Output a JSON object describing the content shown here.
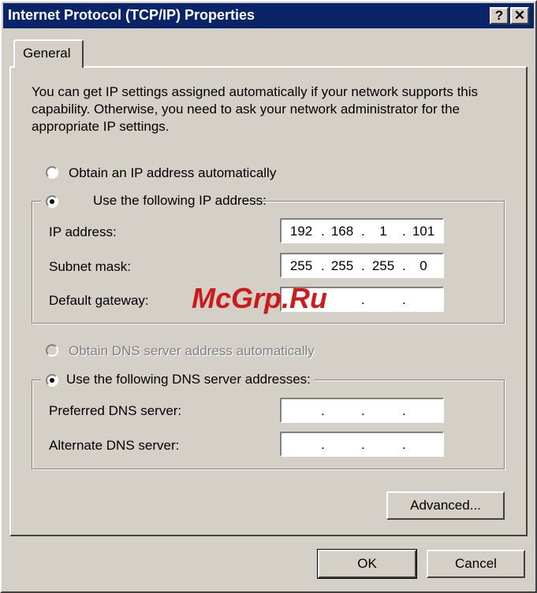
{
  "window": {
    "title": "Internet Protocol (TCP/IP) Properties",
    "help_glyph": "?",
    "close_glyph": "✕"
  },
  "tabs": [
    {
      "label": "General"
    }
  ],
  "description": "You can get IP settings assigned automatically if your network supports this capability. Otherwise, you need to ask your network administrator for the appropriate IP settings.",
  "ip": {
    "auto_option": {
      "label": "Obtain an IP address automatically",
      "selected": false
    },
    "manual_option": {
      "label": "Use the following IP address:",
      "selected": true
    },
    "fields": [
      {
        "label": "IP address:",
        "octets": [
          "192",
          "168",
          "1",
          "101"
        ]
      },
      {
        "label": "Subnet mask:",
        "octets": [
          "255",
          "255",
          "255",
          "0"
        ]
      },
      {
        "label": "Default gateway:",
        "octets": [
          "",
          "",
          "",
          ""
        ]
      }
    ]
  },
  "dns": {
    "auto_option": {
      "label": "Obtain DNS server address automatically",
      "selected": false,
      "disabled": true
    },
    "manual_option": {
      "label": "Use the following DNS server addresses:",
      "selected": true
    },
    "fields": [
      {
        "label": "Preferred DNS server:",
        "octets": [
          "",
          "",
          "",
          ""
        ]
      },
      {
        "label": "Alternate DNS server:",
        "octets": [
          "",
          "",
          "",
          ""
        ]
      }
    ]
  },
  "buttons": {
    "advanced": "Advanced...",
    "ok": "OK",
    "cancel": "Cancel"
  },
  "watermark": "McGrp.Ru",
  "colors": {
    "titlebar": "#0a246a",
    "face": "#d4d0c8",
    "watermark": "#cc1010"
  }
}
